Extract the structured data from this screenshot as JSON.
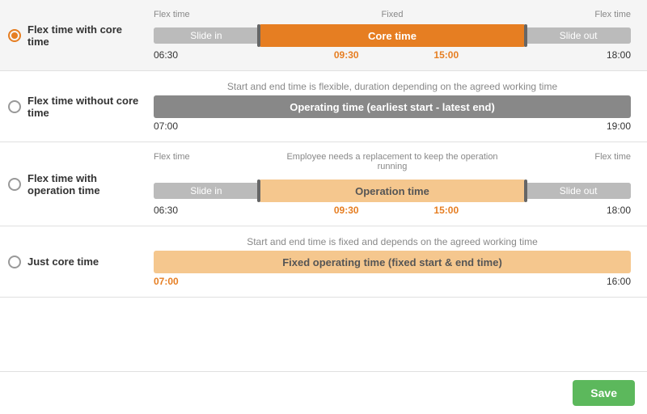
{
  "options": [
    {
      "id": "flex-core",
      "label": "Flex time with core time",
      "selected": true,
      "description": null,
      "top_labels": [
        {
          "text": "Flex time",
          "position": "left"
        },
        {
          "text": "Fixed",
          "position": "center"
        },
        {
          "text": "Flex time",
          "position": "right"
        }
      ],
      "bar": {
        "type": "flex-core",
        "slide_in": "Slide in",
        "core": "Core time",
        "slide_out": "Slide out"
      },
      "time_labels": [
        {
          "text": "06:30",
          "highlight": false
        },
        {
          "text": "09:30",
          "highlight": true
        },
        {
          "text": "15:00",
          "highlight": true
        },
        {
          "text": "18:00",
          "highlight": false
        }
      ]
    },
    {
      "id": "flex-no-core",
      "label": "Flex time without core time",
      "selected": false,
      "description": "Start and end time is flexible, duration depending on the agreed working time",
      "bar": {
        "type": "operating-time",
        "label": "Operating time (earliest start - latest end)"
      },
      "time_labels": [
        {
          "text": "07:00",
          "highlight": false
        },
        {
          "text": "19:00",
          "highlight": false
        }
      ]
    },
    {
      "id": "flex-operation",
      "label": "Flex time with operation time",
      "selected": false,
      "description_line1": "Employee needs a replacement to keep the operation",
      "description_line2": "running",
      "top_labels": [
        {
          "text": "Flex time",
          "position": "left"
        },
        {
          "text": "Flex time",
          "position": "right"
        }
      ],
      "bar": {
        "type": "flex-operation",
        "slide_in": "Slide in",
        "operation": "Operation time",
        "slide_out": "Slide out"
      },
      "time_labels": [
        {
          "text": "06:30",
          "highlight": false
        },
        {
          "text": "09:30",
          "highlight": true
        },
        {
          "text": "15:00",
          "highlight": true
        },
        {
          "text": "18:00",
          "highlight": false
        }
      ]
    },
    {
      "id": "just-core",
      "label": "Just core time",
      "selected": false,
      "description": "Start and end time is fixed and depends on the agreed working time",
      "bar": {
        "type": "fixed-operating",
        "label": "Fixed operating time (fixed start & end time)"
      },
      "time_labels": [
        {
          "text": "07:00",
          "highlight": true
        },
        {
          "text": "16:00",
          "highlight": false
        }
      ]
    }
  ],
  "footer": {
    "save_label": "Save"
  }
}
